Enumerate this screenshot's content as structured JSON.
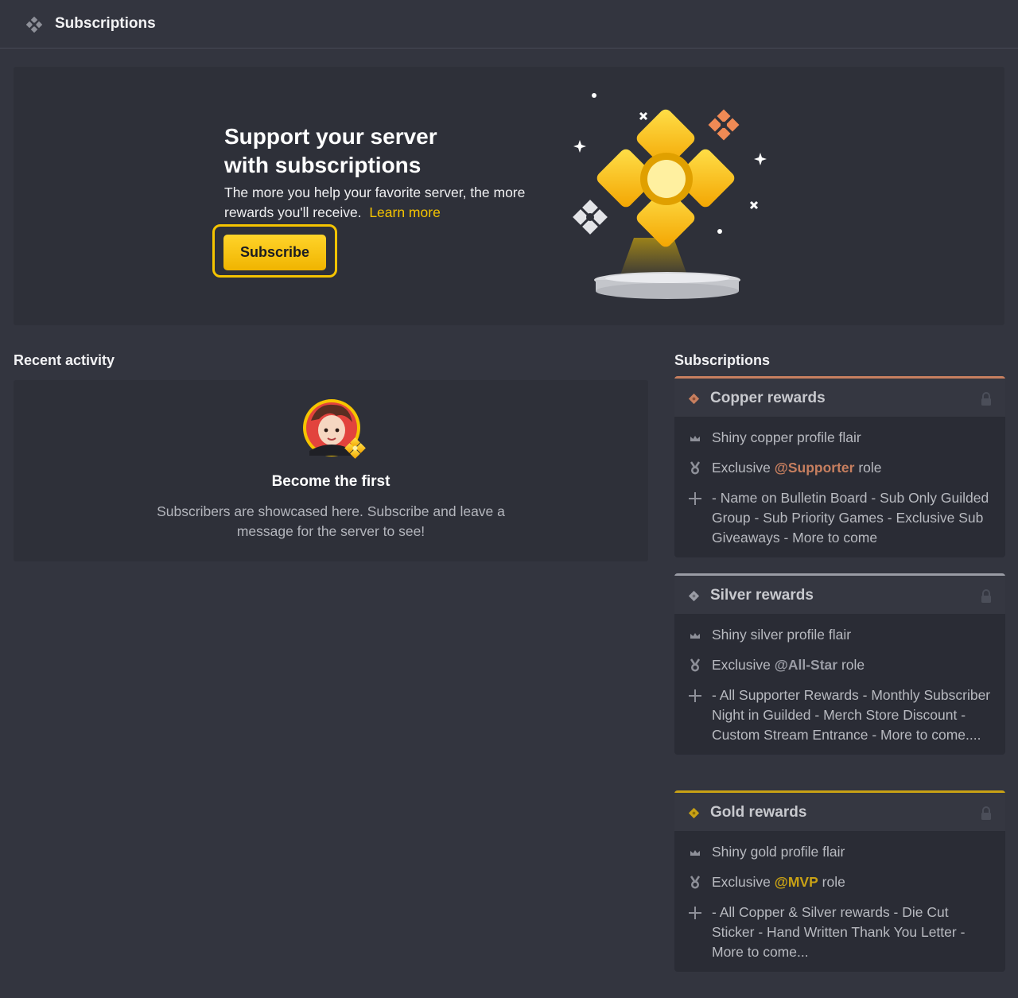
{
  "header": {
    "title": "Subscriptions",
    "icon": "subscriptions-gem-icon"
  },
  "hero": {
    "headline_line1": "Support your server",
    "headline_line2": "with subscriptions",
    "desc_text": "The more you help your favorite server, the more rewards you'll receive.",
    "learn_more": "Learn more",
    "subscribe_label": "Subscribe",
    "accent_color": "#f5c400"
  },
  "recent_activity": {
    "label": "Recent activity",
    "heading": "Become the first",
    "message": "Subscribers are showcased here. Subscribe and leave a message for the server to see!"
  },
  "subscriptions": {
    "label": "Subscriptions",
    "tiers": [
      {
        "name": "Copper rewards",
        "color": "#c77f5f",
        "flair": "Shiny copper profile flair",
        "role_prefix": "Exclusive ",
        "role": "@Supporter",
        "role_suffix": " role",
        "extras": "- Name on Bulletin Board - Sub Only Guilded Group - Sub Priority Games - Exclusive Sub Giveaways - More to come"
      },
      {
        "name": "Silver rewards",
        "color": "#9a9ca5",
        "flair": "Shiny silver profile flair",
        "role_prefix": "Exclusive ",
        "role": "@All-Star",
        "role_suffix": " role",
        "extras": "- All Supporter Rewards - Monthly Subscriber Night in Guilded - Merch Store Discount - Custom Stream Entrance - More to come...."
      },
      {
        "name": "Gold rewards",
        "color": "#c9a215",
        "flair": "Shiny gold profile flair",
        "role_prefix": "Exclusive ",
        "role": "@MVP",
        "role_suffix": " role",
        "extras": "- All Copper & Silver rewards - Die Cut Sticker - Hand Written Thank You Letter - More to come..."
      }
    ]
  }
}
